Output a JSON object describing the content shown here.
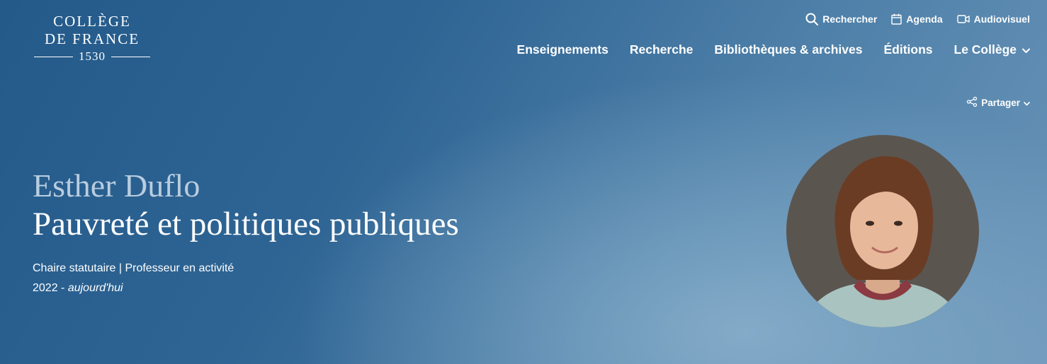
{
  "logo": {
    "line1": "COLLÈGE",
    "line2": "DE FRANCE",
    "year": "1530"
  },
  "utility_nav": [
    {
      "label": "Rechercher",
      "icon": "search-icon"
    },
    {
      "label": "Agenda",
      "icon": "calendar-icon"
    },
    {
      "label": "Audiovisuel",
      "icon": "video-camera-icon"
    }
  ],
  "main_nav": [
    {
      "label": "Enseignements"
    },
    {
      "label": "Recherche"
    },
    {
      "label": "Bibliothèques & archives"
    },
    {
      "label": "Éditions"
    },
    {
      "label": "Le Collège",
      "icon": "chevron-down-icon"
    }
  ],
  "share": {
    "label": "Partager",
    "icon": "share-icon"
  },
  "professor": {
    "name": "Esther Duflo",
    "chair_title": "Pauvreté et politiques publiques",
    "status": "Chaire statutaire | Professeur en activité",
    "period_start": "2022 - ",
    "period_end": "aujourd'hui"
  },
  "colors": {
    "background_start": "#235a8a",
    "background_end": "#6a94b8",
    "name_color": "#b9cde0",
    "text": "#ffffff"
  }
}
